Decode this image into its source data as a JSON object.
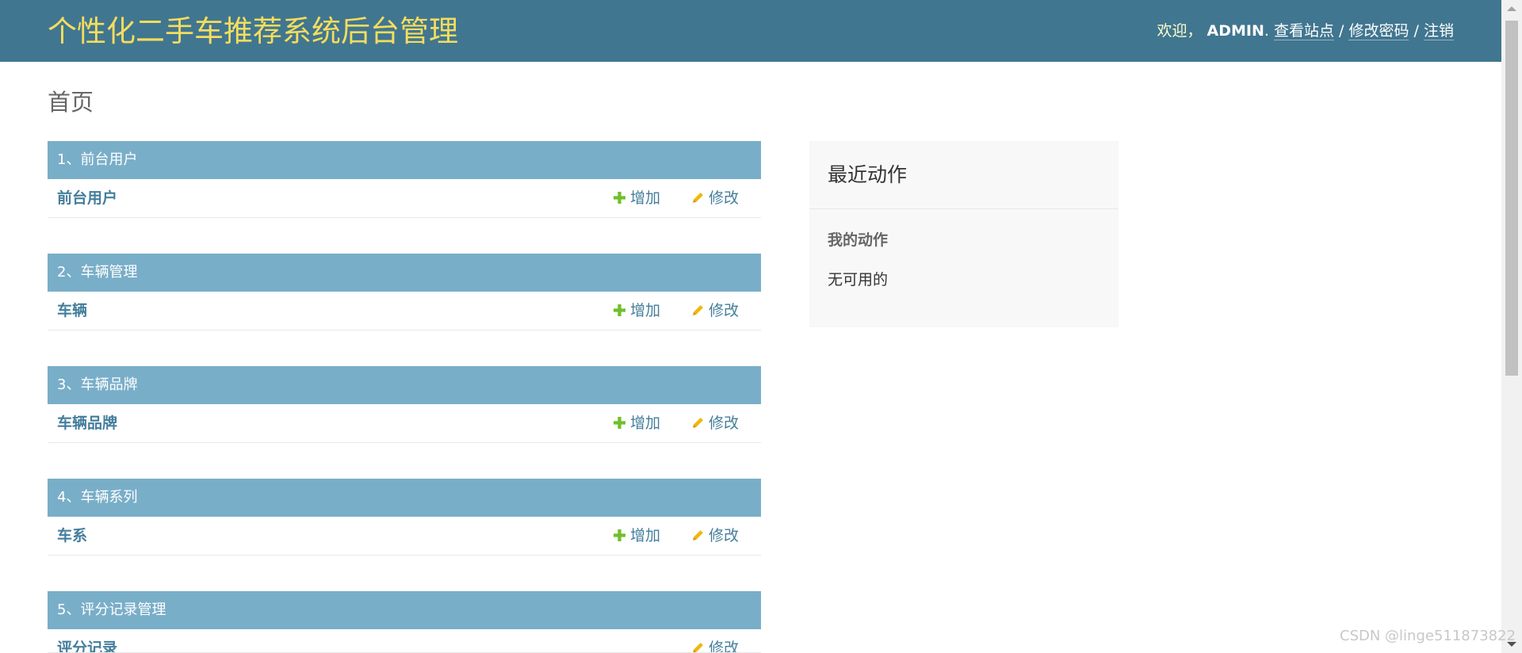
{
  "header": {
    "brand": "个性化二手车推荐系统后台管理",
    "welcome": "欢迎，",
    "username": "ADMIN",
    "period": ".",
    "view_site": "查看站点",
    "sep": "/",
    "change_password": "修改密码",
    "logout": "注销"
  },
  "page": {
    "title": "首页"
  },
  "modules": [
    {
      "caption": "1、前台用户",
      "model": "前台用户",
      "add": "增加",
      "change": "修改"
    },
    {
      "caption": "2、车辆管理",
      "model": "车辆",
      "add": "增加",
      "change": "修改"
    },
    {
      "caption": "3、车辆品牌",
      "model": "车辆品牌",
      "add": "增加",
      "change": "修改"
    },
    {
      "caption": "4、车辆系列",
      "model": "车系",
      "add": "增加",
      "change": "修改"
    },
    {
      "caption": "5、评分记录管理",
      "model": "评分记录",
      "change": "修改"
    }
  ],
  "recent": {
    "title": "最近动作",
    "subtitle": "我的动作",
    "empty": "无可用的"
  },
  "watermark": "CSDN @linge511873822",
  "colors": {
    "header_bg": "#417690",
    "brand": "#f5dd5d",
    "caption_bg": "#79aec8",
    "link": "#447e9b",
    "add_icon": "#70bf2b",
    "change_icon": "#efb80b"
  }
}
